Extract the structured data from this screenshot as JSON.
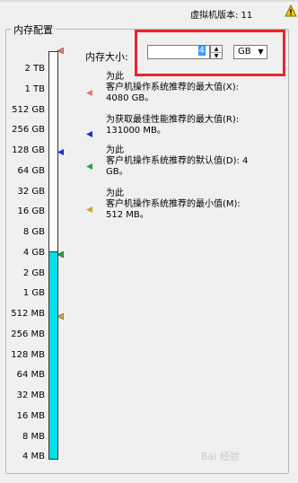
{
  "header": {
    "hw_version": "虚拟机版本: 11"
  },
  "group": {
    "title": "内存配置"
  },
  "scale": {
    "ticks": [
      "2 TB",
      "1 TB",
      "512 GB",
      "256 GB",
      "128 GB",
      "64 GB",
      "32 GB",
      "16 GB",
      "8 GB",
      "4 GB",
      "2 GB",
      "1 GB",
      "512 MB",
      "256 MB",
      "128 MB",
      "64 MB",
      "32 MB",
      "16 MB",
      "8 MB",
      "4 MB"
    ]
  },
  "memory": {
    "label": "内存大小:",
    "value": "4",
    "unit": "GB"
  },
  "recommendations": [
    {
      "line1": "为此",
      "line2": "客户机操作系统推荐的最大值(X):",
      "line3": "4080 GB。",
      "color": "#e87a6a"
    },
    {
      "line1": "为获取最佳性能推荐的最大值(R):",
      "line2": "",
      "line3": "131000 MB。",
      "color": "#1a2fd6"
    },
    {
      "line1": "为此",
      "line2": "客户机操作系统推荐的默认值(D): 4",
      "line3": "GB。",
      "color": "#2aa637"
    },
    {
      "line1": "为此",
      "line2": "客户机操作系统推荐的最小值(M):",
      "line3": "512 MB。",
      "color": "#d9a227"
    }
  ],
  "watermark": "Bai 经验"
}
